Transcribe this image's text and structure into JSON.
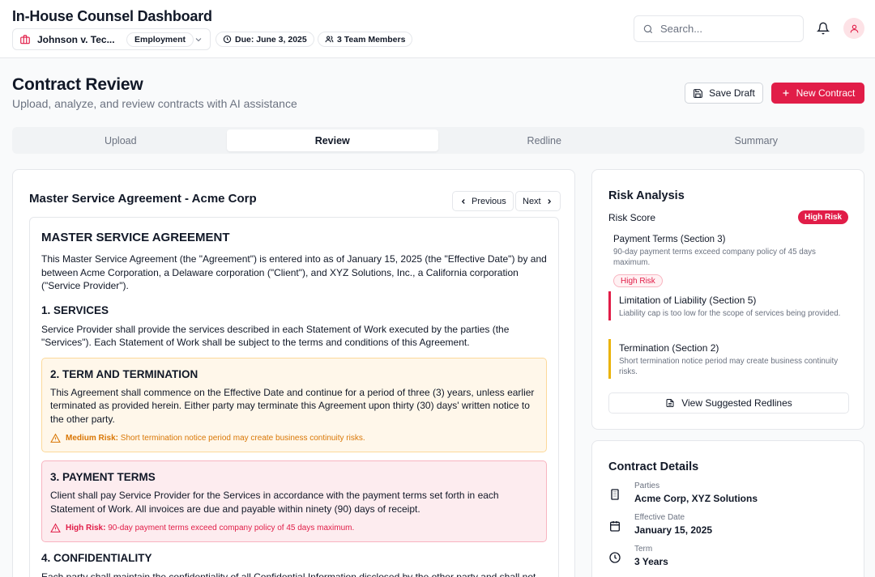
{
  "header": {
    "app_title": "In-House Counsel Dashboard",
    "case_name": "Johnson v. Tec...",
    "case_type": "Employment",
    "due": "Due: June 3, 2025",
    "team": "3 Team Members",
    "search_placeholder": "Search..."
  },
  "page": {
    "title": "Contract Review",
    "subtitle": "Upload, analyze, and review contracts with AI assistance",
    "save_label": "Save Draft",
    "new_label": "New Contract"
  },
  "tabs": [
    {
      "label": "Upload"
    },
    {
      "label": "Review",
      "active": true
    },
    {
      "label": "Redline"
    },
    {
      "label": "Summary"
    }
  ],
  "document": {
    "title": "Master Service Agreement - Acme Corp",
    "previous_label": "Previous",
    "next_label": "Next",
    "heading": "MASTER SERVICE AGREEMENT",
    "intro": "This Master Service Agreement (the \"Agreement\") is entered into as of January 15, 2025 (the \"Effective Date\") by and between Acme Corporation, a Delaware corporation (\"Client\"), and XYZ Solutions, Inc., a California corporation (\"Service Provider\").",
    "sections": [
      {
        "heading": "1. SERVICES",
        "text": "Service Provider shall provide the services described in each Statement of Work executed by the parties (the \"Services\"). Each Statement of Work shall be subject to the terms and conditions of this Agreement."
      },
      {
        "heading": "2. TERM AND TERMINATION",
        "text": "This Agreement shall commence on the Effective Date and continue for a period of three (3) years, unless earlier terminated as provided herein. Either party may terminate this Agreement upon thirty (30) days' written notice to the other party.",
        "risk_level": "Medium Risk:",
        "risk_text": "Short termination notice period may create business continuity risks."
      },
      {
        "heading": "3. PAYMENT TERMS",
        "text": "Client shall pay Service Provider for the Services in accordance with the payment terms set forth in each Statement of Work. All invoices are due and payable within ninety (90) days of receipt.",
        "risk_level": "High Risk:",
        "risk_text": "90-day payment terms exceed company policy of 45 days maximum."
      },
      {
        "heading": "4. CONFIDENTIALITY",
        "text": "Each party shall maintain the confidentiality of all Confidential Information disclosed by the other party and shall not"
      }
    ]
  },
  "risk": {
    "title": "Risk Analysis",
    "score_label": "Risk Score",
    "score_badge": "High Risk",
    "items": [
      {
        "title": "Payment Terms (Section 3)",
        "desc": "90-day payment terms exceed company policy of 45 days maximum.",
        "badge": "High Risk"
      },
      {
        "title": "Limitation of Liability (Section 5)",
        "desc": "Liability cap is too low for the scope of services being provided."
      },
      {
        "title": "Termination (Section 2)",
        "desc": "Short termination notice period may create business continuity risks."
      }
    ],
    "redlines_label": "View Suggested Redlines"
  },
  "details": {
    "title": "Contract Details",
    "items": [
      {
        "label": "Parties",
        "value": "Acme Corp, XYZ Solutions",
        "icon": "building-icon"
      },
      {
        "label": "Effective Date",
        "value": "January 15, 2025",
        "icon": "calendar-icon"
      },
      {
        "label": "Term",
        "value": "3 Years",
        "icon": "clock-icon"
      }
    ]
  },
  "colors": {
    "accent": "#e11d48",
    "medium_risk": "#d97706",
    "amber_bar": "#eab308"
  }
}
